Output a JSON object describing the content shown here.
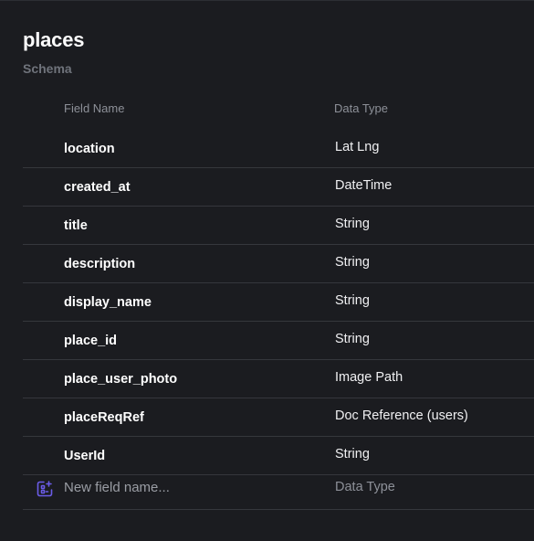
{
  "collection": {
    "title": "places",
    "subtitle": "Schema"
  },
  "columns": {
    "field_name": "Field Name",
    "data_type": "Data Type"
  },
  "fields": [
    {
      "name": "location",
      "type": "Lat Lng"
    },
    {
      "name": "created_at",
      "type": "DateTime"
    },
    {
      "name": "title",
      "type": "String"
    },
    {
      "name": "description",
      "type": "String"
    },
    {
      "name": "display_name",
      "type": "String"
    },
    {
      "name": "place_id",
      "type": "String"
    },
    {
      "name": "place_user_photo",
      "type": "Image Path"
    },
    {
      "name": "placeReqRef",
      "type": "Doc Reference (users)"
    },
    {
      "name": "UserId",
      "type": "String"
    }
  ],
  "new_field": {
    "placeholder": "New field name...",
    "type_placeholder": "Data Type",
    "icon": "add-field-icon",
    "accent": "#6b5ce7"
  }
}
